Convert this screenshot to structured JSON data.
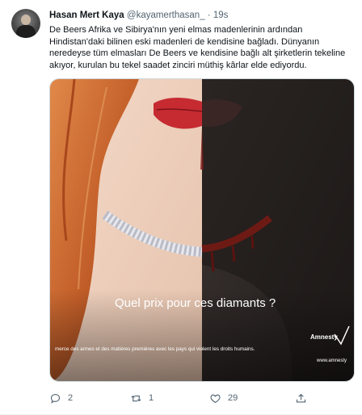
{
  "tweet": {
    "author_name": "Hasan Mert Kaya",
    "handle": "@kayamerthasan_",
    "separator": "·",
    "time": "19s",
    "text": "De Beers Afrika ve Sibirya'nın yeni elmas madenlerinin ardından Hindistan'daki bilinen eski madenleri de kendisine bağladı. Dünyanın neredeyse tüm elmasları De Beers ve kendisine bağlı alt şirketlerin tekeline akıyor, kurulan bu tekel saadet zinciri müthiş kârlar elde ediyordu.",
    "image": {
      "headline": "Quel prix pour ces diamants ?",
      "footer": "merce des armes et des matières premières avec les pays qui violent les droits humains.",
      "logo_text": "Amnesty",
      "url_text": "www.amnesty"
    },
    "actions": {
      "reply_icon": "reply-icon",
      "reply_count": "2",
      "retweet_icon": "retweet-icon",
      "retweet_count": "1",
      "like_icon": "heart-icon",
      "like_count": "29",
      "share_icon": "share-icon"
    }
  },
  "colors": {
    "text_primary": "#0f1419",
    "text_secondary": "#536471",
    "border": "#cfd9de",
    "lips": "#c62b32",
    "hair": "#c4602a",
    "dark_skin": "#2b2624"
  }
}
